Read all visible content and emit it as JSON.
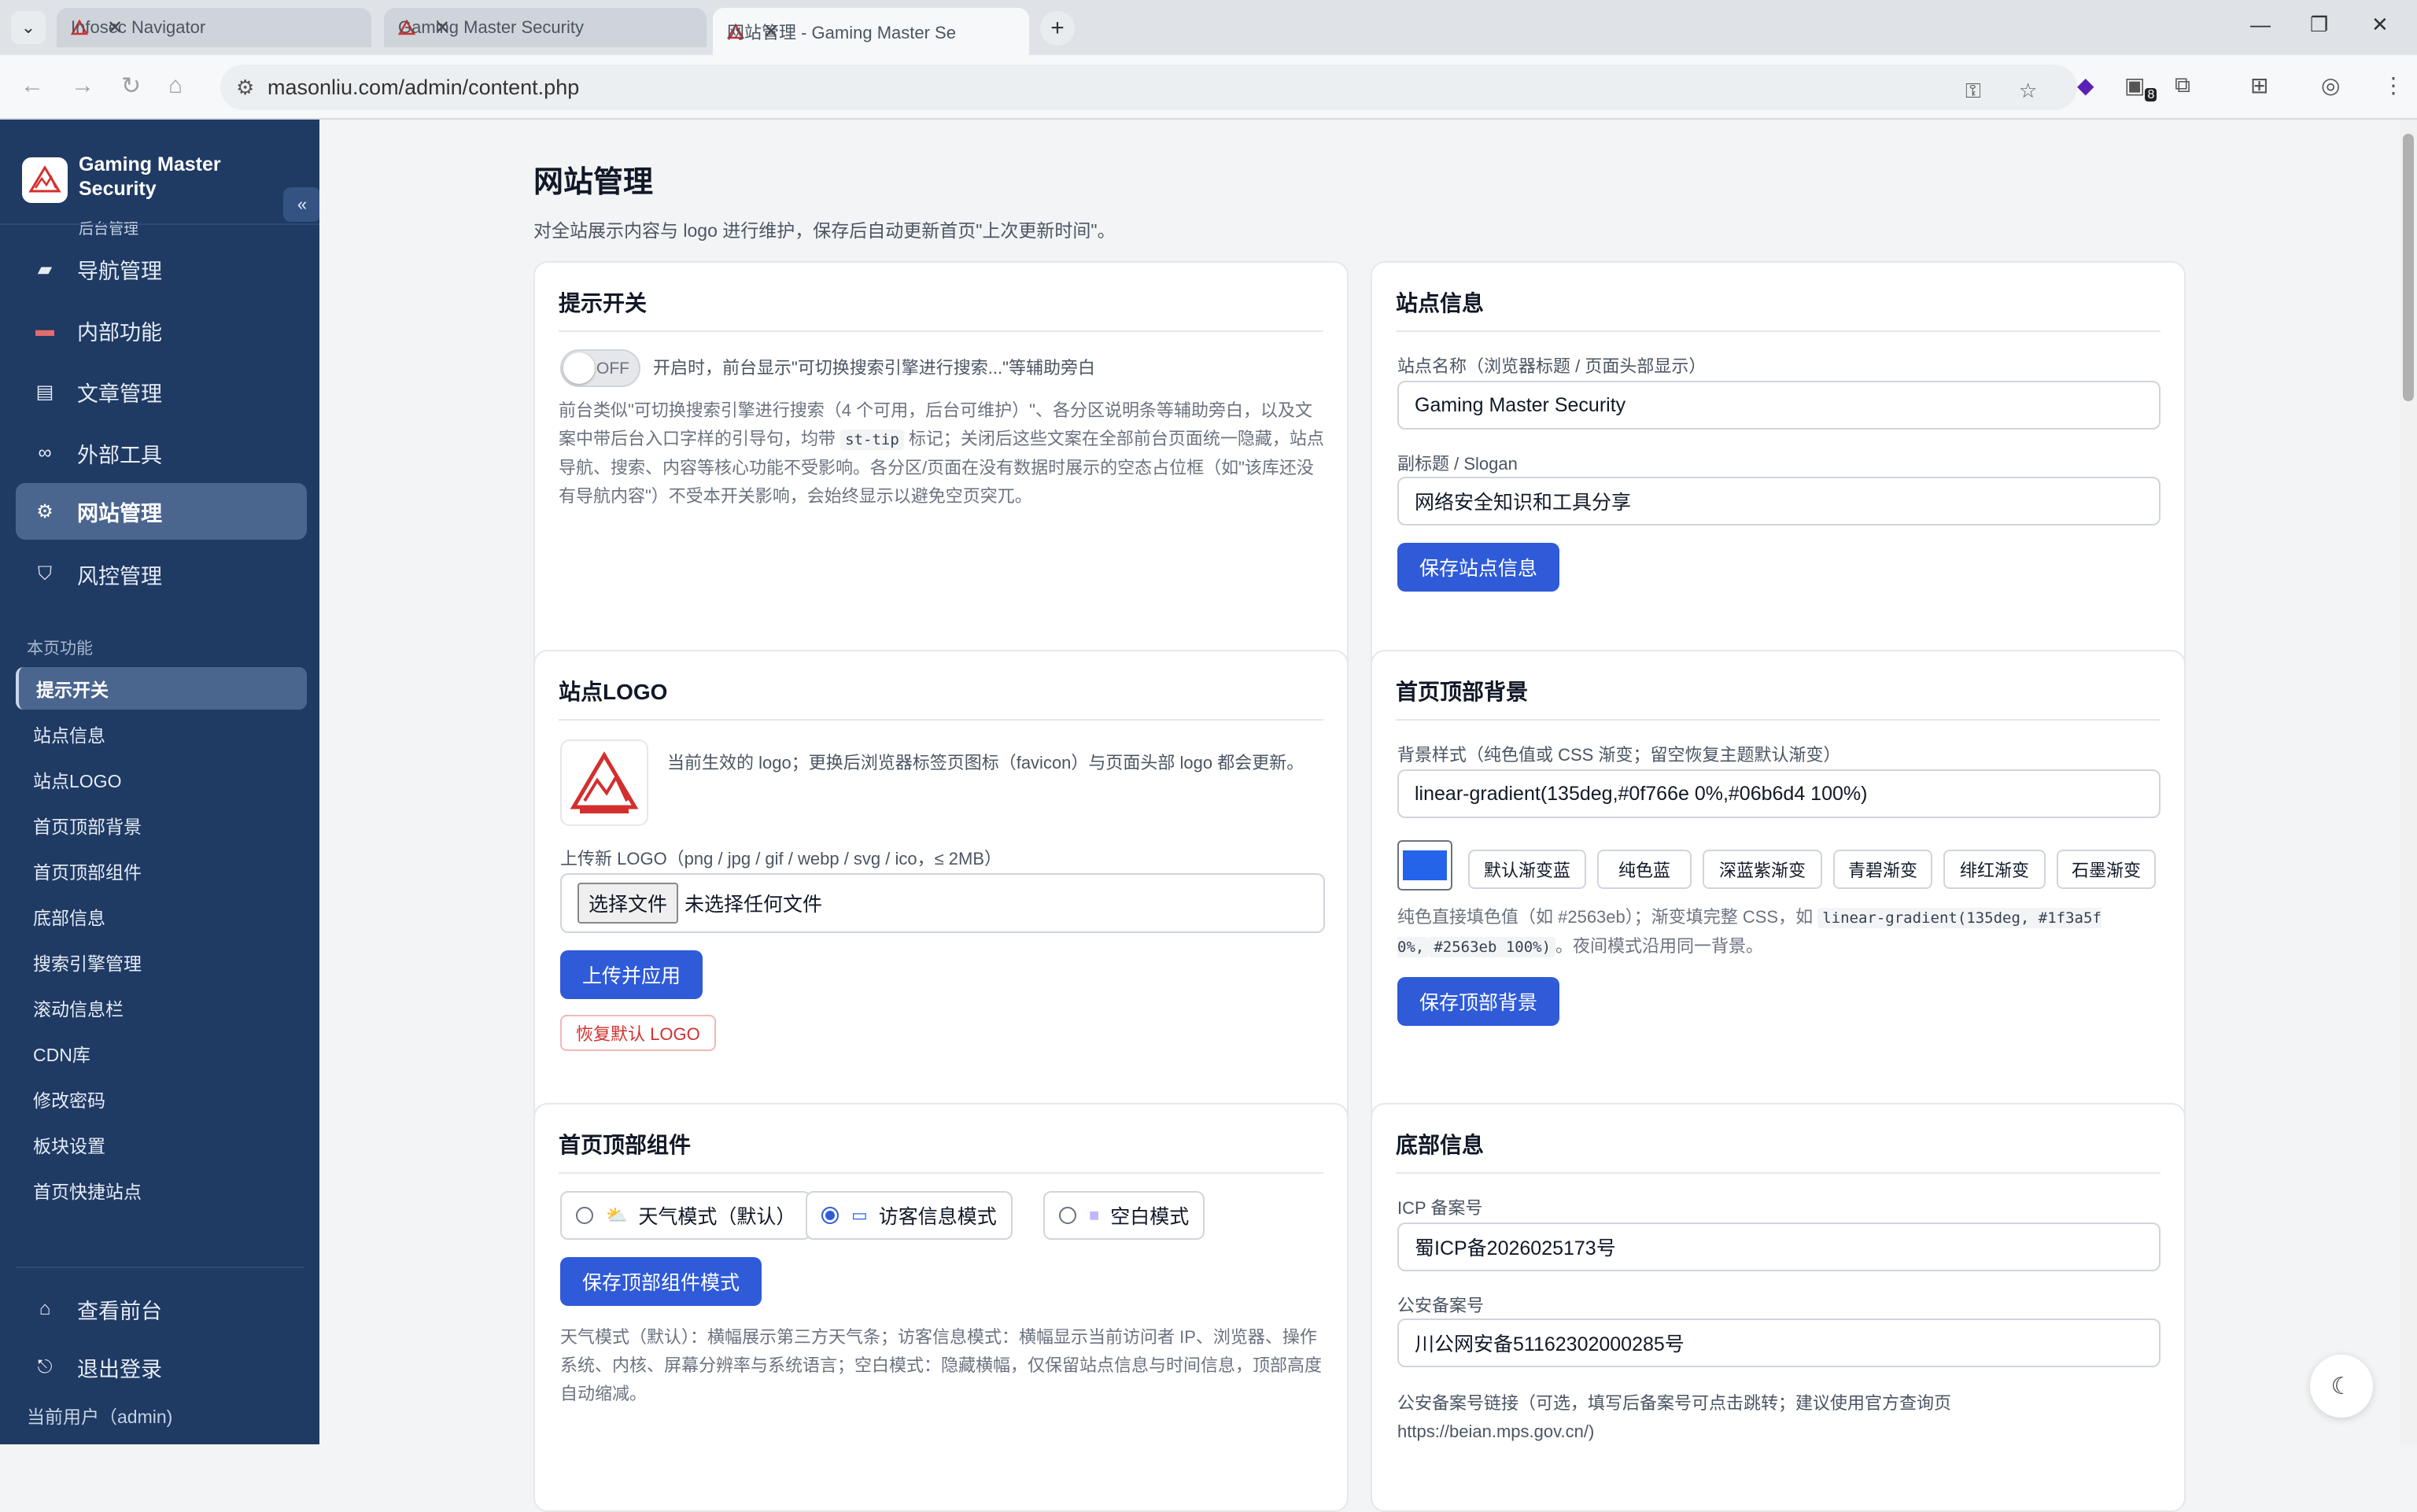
{
  "browser": {
    "tabs": [
      {
        "title": "Infosec Navigator",
        "active": false
      },
      {
        "title": "Gaming Master Security",
        "active": false
      },
      {
        "title": "网站管理 - Gaming Master Se",
        "active": true
      }
    ],
    "url": "masonliu.com/admin/content.php",
    "ext_badge": "8"
  },
  "sidebar": {
    "brand_title": "Gaming Master Security",
    "brand_sub": "后台管理",
    "collapse_icon": "«",
    "nav": [
      {
        "label": "导航管理",
        "icon": "folder-icon",
        "active": false
      },
      {
        "label": "内部功能",
        "icon": "toolbox-icon",
        "active": false
      },
      {
        "label": "文章管理",
        "icon": "document-icon",
        "active": false
      },
      {
        "label": "外部工具",
        "icon": "link-icon",
        "active": false
      },
      {
        "label": "网站管理",
        "icon": "gear-icon",
        "active": true
      },
      {
        "label": "风控管理",
        "icon": "shield-icon",
        "active": false
      }
    ],
    "section_label": "本页功能",
    "sub": [
      {
        "label": "提示开关",
        "active": true
      },
      {
        "label": "站点信息",
        "active": false
      },
      {
        "label": "站点LOGO",
        "active": false
      },
      {
        "label": "首页顶部背景",
        "active": false
      },
      {
        "label": "首页顶部组件",
        "active": false
      },
      {
        "label": "底部信息",
        "active": false
      },
      {
        "label": "搜索引擎管理",
        "active": false
      },
      {
        "label": "滚动信息栏",
        "active": false
      },
      {
        "label": "CDN库",
        "active": false
      },
      {
        "label": "修改密码",
        "active": false
      },
      {
        "label": "板块设置",
        "active": false
      },
      {
        "label": "首页快捷站点",
        "active": false
      }
    ],
    "view_front": "查看前台",
    "logout": "退出登录",
    "current_user": "当前用户（admin)"
  },
  "main": {
    "title": "网站管理",
    "desc": "对全站展示内容与 logo 进行维护，保存后自动更新首页\"上次更新时间\"。",
    "tip_switch": {
      "title": "提示开关",
      "toggle_text": "OFF",
      "toggle_desc": "开启时，前台显示\"可切换搜索引擎进行搜索...\"等辅助旁白",
      "help_1": "前台类似\"可切换搜索引擎进行搜索（4 个可用，后台可维护）\"、各分区说明条等辅助旁白，以及文案中带后台入口字样的引导句，均带 ",
      "help_code": "st-tip",
      "help_2": " 标记；关闭后这些文案在全部前台页面统一隐藏，站点导航、搜索、内容等核心功能不受影响。各分区/页面在没有数据时展示的空态占位框（如\"该库还没有导航内容\"）不受本开关影响，会始终显示以避免空页突兀。"
    },
    "site_info": {
      "title": "站点信息",
      "name_label": "站点名称（浏览器标题 / 页面头部显示）",
      "name_value": "Gaming Master Security",
      "slogan_label": "副标题 / Slogan",
      "slogan_value": "网络安全知识和工具分享",
      "save": "保存站点信息"
    },
    "logo": {
      "title": "站点LOGO",
      "desc": "当前生效的 logo；更换后浏览器标签页图标（favicon）与页面头部 logo 都会更新。",
      "upload_label": "上传新 LOGO（png / jpg / gif / webp / svg / ico，≤ 2MB）",
      "file_btn": "选择文件",
      "file_none": "未选择任何文件",
      "upload_apply": "上传并应用",
      "restore": "恢复默认 LOGO"
    },
    "top_bg": {
      "title": "首页顶部背景",
      "style_label": "背景样式（纯色值或 CSS 渐变；留空恢复主题默认渐变）",
      "style_value": "linear-gradient(135deg,#0f766e 0%,#06b6d4 100%)",
      "swatch_color": "#2563eb",
      "presets": [
        "默认渐变蓝",
        "纯色蓝",
        "深蓝紫渐变",
        "青碧渐变",
        "绯红渐变",
        "石墨渐变"
      ],
      "help_1": "纯色直接填色值（如 #2563eb）；渐变填完整 CSS，如 ",
      "help_code_1": "linear-gradient(135deg, #1f3a5f 0%,",
      "help_code_2": "#2563eb 100%)",
      "help_2": "。夜间模式沿用同一背景。",
      "save": "保存顶部背景"
    },
    "top_widget": {
      "title": "首页顶部组件",
      "options": [
        {
          "label": "天气模式（默认）",
          "icon": "weather-icon",
          "checked": false
        },
        {
          "label": "访客信息模式",
          "icon": "monitor-icon",
          "checked": true
        },
        {
          "label": "空白模式",
          "icon": "blank-icon",
          "checked": false
        }
      ],
      "save": "保存顶部组件模式",
      "help": "天气模式（默认）：横幅展示第三方天气条；访客信息模式：横幅显示当前访问者 IP、浏览器、操作系统、内核、屏幕分辨率与系统语言；空白模式：隐藏横幅，仅保留站点信息与时间信息，顶部高度自动缩减。"
    },
    "footer": {
      "title": "底部信息",
      "icp_label": "ICP 备案号",
      "icp_value": "蜀ICP备2026025173号",
      "police_label": "公安备案号",
      "police_value": "川公网安备51162302000285号",
      "police_link_label": "公安备案号链接（可选，填写后备案号可点击跳转；建议使用官方查询页",
      "police_link_label_2": "https://beian.mps.gov.cn/)"
    }
  }
}
